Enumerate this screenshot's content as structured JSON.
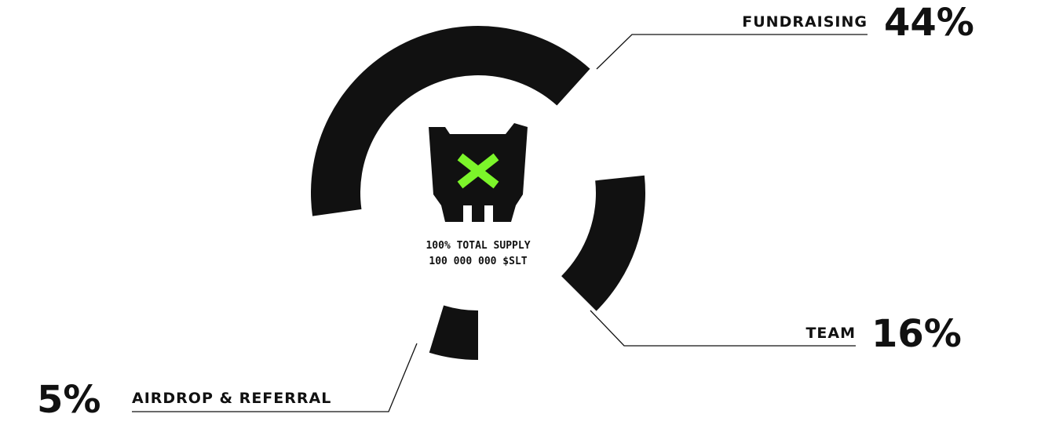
{
  "chart_data": {
    "type": "pie",
    "variant": "donut",
    "center_text": {
      "line1": "100% TOTAL SUPPLY",
      "line2": "100 000 000 $SLT"
    },
    "slices": [
      {
        "label": "FUNDRAISING",
        "value": 44,
        "value_text": "44%"
      },
      {
        "label": "TEAM",
        "value": 16,
        "value_text": "16%"
      },
      {
        "label": "AIRDROP & REFERRAL",
        "value": 5,
        "value_text": "5%"
      }
    ]
  },
  "colors": {
    "segment": "#111111",
    "logo_body": "#111111",
    "logo_x": "#7cf52a"
  },
  "icons": {
    "center_logo": "token-logo-icon",
    "center_mark": "x-mark-icon"
  }
}
